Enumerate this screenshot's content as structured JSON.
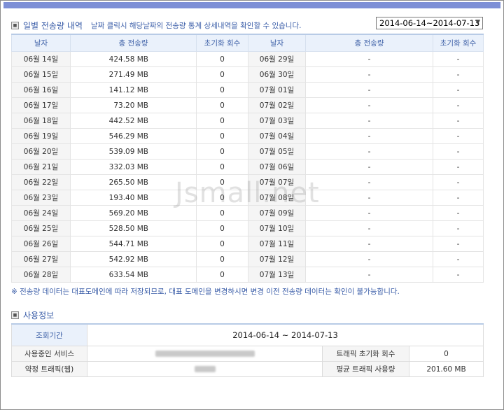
{
  "daily_section": {
    "title": "일별 전송량 내역",
    "description": "날짜 클릭시 해당날짜의 전송량 통계 상세내역을 확인할 수 있습니다.",
    "range_value": "2014-06-14~2014-07-13",
    "headers": {
      "date": "날자",
      "transfer": "총 전송량",
      "reset": "초기화 회수"
    },
    "left_rows": [
      {
        "date": "06월 14일",
        "transfer": "424.58 MB",
        "reset": "0"
      },
      {
        "date": "06월 15일",
        "transfer": "271.49 MB",
        "reset": "0"
      },
      {
        "date": "06월 16일",
        "transfer": "141.12 MB",
        "reset": "0"
      },
      {
        "date": "06월 17일",
        "transfer": "73.20 MB",
        "reset": "0"
      },
      {
        "date": "06월 18일",
        "transfer": "442.52 MB",
        "reset": "0"
      },
      {
        "date": "06월 19일",
        "transfer": "546.29 MB",
        "reset": "0"
      },
      {
        "date": "06월 20일",
        "transfer": "539.09 MB",
        "reset": "0"
      },
      {
        "date": "06월 21일",
        "transfer": "332.03 MB",
        "reset": "0"
      },
      {
        "date": "06월 22일",
        "transfer": "265.50 MB",
        "reset": "0"
      },
      {
        "date": "06월 23일",
        "transfer": "193.40 MB",
        "reset": "0"
      },
      {
        "date": "06월 24일",
        "transfer": "569.20 MB",
        "reset": "0"
      },
      {
        "date": "06월 25일",
        "transfer": "528.50 MB",
        "reset": "0"
      },
      {
        "date": "06월 26일",
        "transfer": "544.71 MB",
        "reset": "0"
      },
      {
        "date": "06월 27일",
        "transfer": "542.92 MB",
        "reset": "0"
      },
      {
        "date": "06월 28일",
        "transfer": "633.54 MB",
        "reset": "0"
      }
    ],
    "right_rows": [
      {
        "date": "06월 29일",
        "transfer": "-",
        "reset": "-"
      },
      {
        "date": "06월 30일",
        "transfer": "-",
        "reset": "-"
      },
      {
        "date": "07월 01일",
        "transfer": "-",
        "reset": "-"
      },
      {
        "date": "07월 02일",
        "transfer": "-",
        "reset": "-"
      },
      {
        "date": "07월 03일",
        "transfer": "-",
        "reset": "-"
      },
      {
        "date": "07월 04일",
        "transfer": "-",
        "reset": "-"
      },
      {
        "date": "07월 05일",
        "transfer": "-",
        "reset": "-"
      },
      {
        "date": "07월 06일",
        "transfer": "-",
        "reset": "-"
      },
      {
        "date": "07월 07일",
        "transfer": "-",
        "reset": "-"
      },
      {
        "date": "07월 08일",
        "transfer": "-",
        "reset": "-"
      },
      {
        "date": "07월 09일",
        "transfer": "-",
        "reset": "-"
      },
      {
        "date": "07월 10일",
        "transfer": "-",
        "reset": "-"
      },
      {
        "date": "07월 11일",
        "transfer": "-",
        "reset": "-"
      },
      {
        "date": "07월 12일",
        "transfer": "-",
        "reset": "-"
      },
      {
        "date": "07월 13일",
        "transfer": "-",
        "reset": "-"
      }
    ],
    "notice": "※ 전송량 데이터는 대표도메인에 따라 저장되므로, 대표 도메인을 변경하시면 변경 이전 전송량 데이터는 확인이 불가능합니다."
  },
  "usage_section": {
    "title": "사용정보",
    "period_label": "조회기간",
    "period_value": "2014-06-14 ~ 2014-07-13",
    "service_label": "사용중인 서비스",
    "reset_count_label": "트래픽 초기화 회수",
    "reset_count_value": "0",
    "contract_label": "약정 트래픽(웹)",
    "avg_usage_label": "평균 트래픽 사용량",
    "avg_usage_value": "201.60 MB"
  },
  "watermark": "Jsmall.net",
  "colors": {
    "top_bar": "#7d8fd6",
    "title_text": "#3a5da8",
    "header_bg": "#eaf1fb"
  }
}
